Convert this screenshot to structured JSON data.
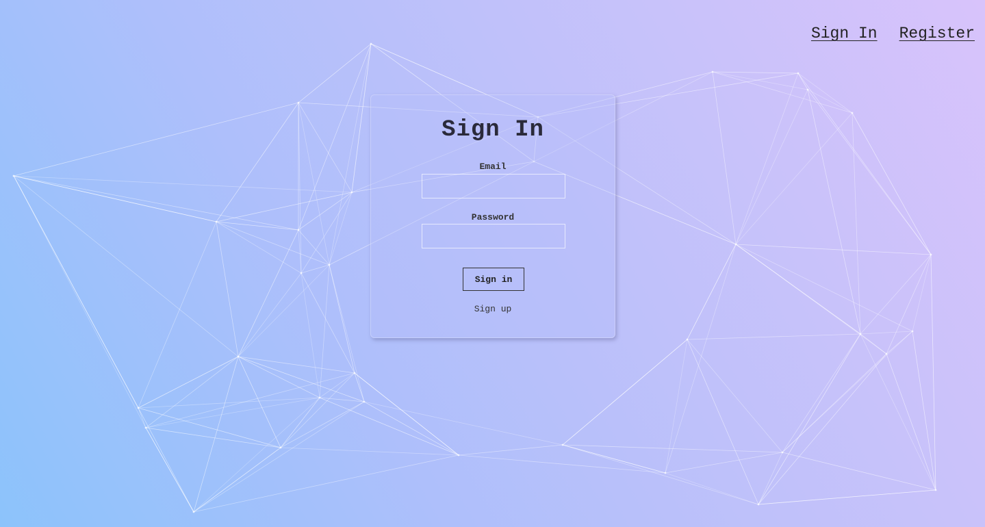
{
  "nav": {
    "signin_label": "Sign In",
    "register_label": "Register"
  },
  "form": {
    "title": "Sign In",
    "email_label": "Email",
    "email_value": "",
    "password_label": "Password",
    "password_value": "",
    "submit_label": "Sign in",
    "signup_label": "Sign up"
  },
  "theme": {
    "gradient_start": "#8cc3fb",
    "gradient_end": "#d8c3fb",
    "network_line_color": "#ffffff"
  }
}
